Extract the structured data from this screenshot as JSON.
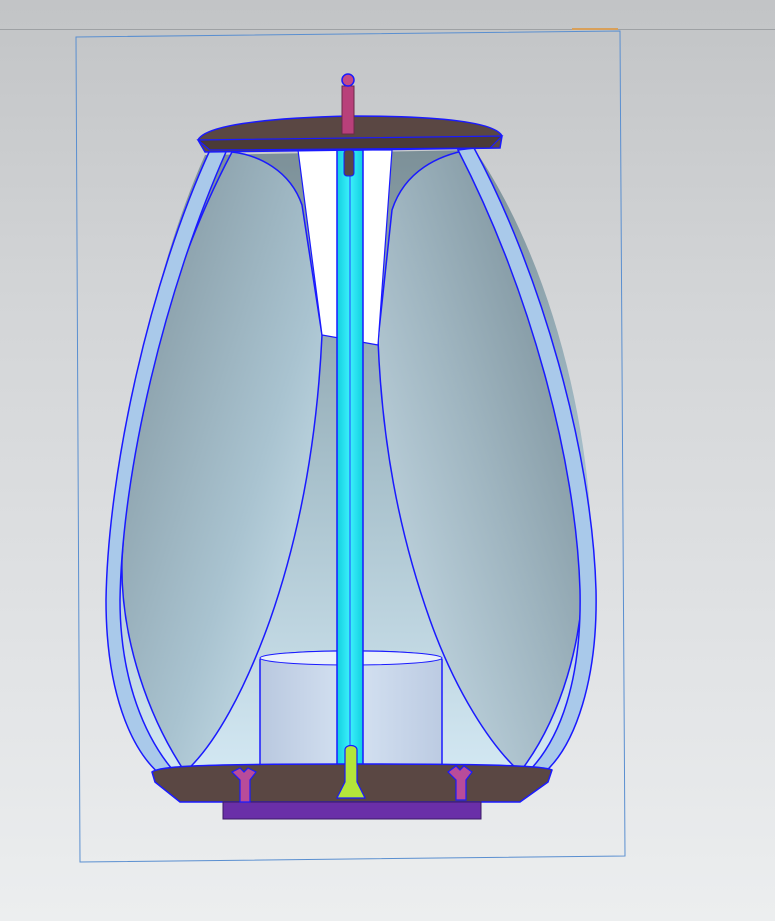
{
  "viewport": {
    "background_top": "#c2c4c6",
    "background_bottom": "#eceeef"
  },
  "model": {
    "view": "section",
    "edge_color": "#1a1aff",
    "colors": {
      "frame_line": "#5a8fd0",
      "shell_fill": "#a9c9ea",
      "inner_gradient_light": "#d7ecf6",
      "inner_gradient_dark": "#6f848e",
      "rod": "#26e2f0",
      "cap_and_base": "#5a4743",
      "pin": "#b8407a",
      "screw": "#b84c9a",
      "plate": "#6a2fa8",
      "cylinder": "#c9d7ec",
      "center_screw": "#b4e53a"
    },
    "parts": [
      "top-cap",
      "top-pin",
      "outer-shell",
      "inner-reflector",
      "center-rod",
      "cylinder",
      "base-plate",
      "bottom-plate",
      "left-screw",
      "right-screw",
      "center-screw"
    ]
  }
}
